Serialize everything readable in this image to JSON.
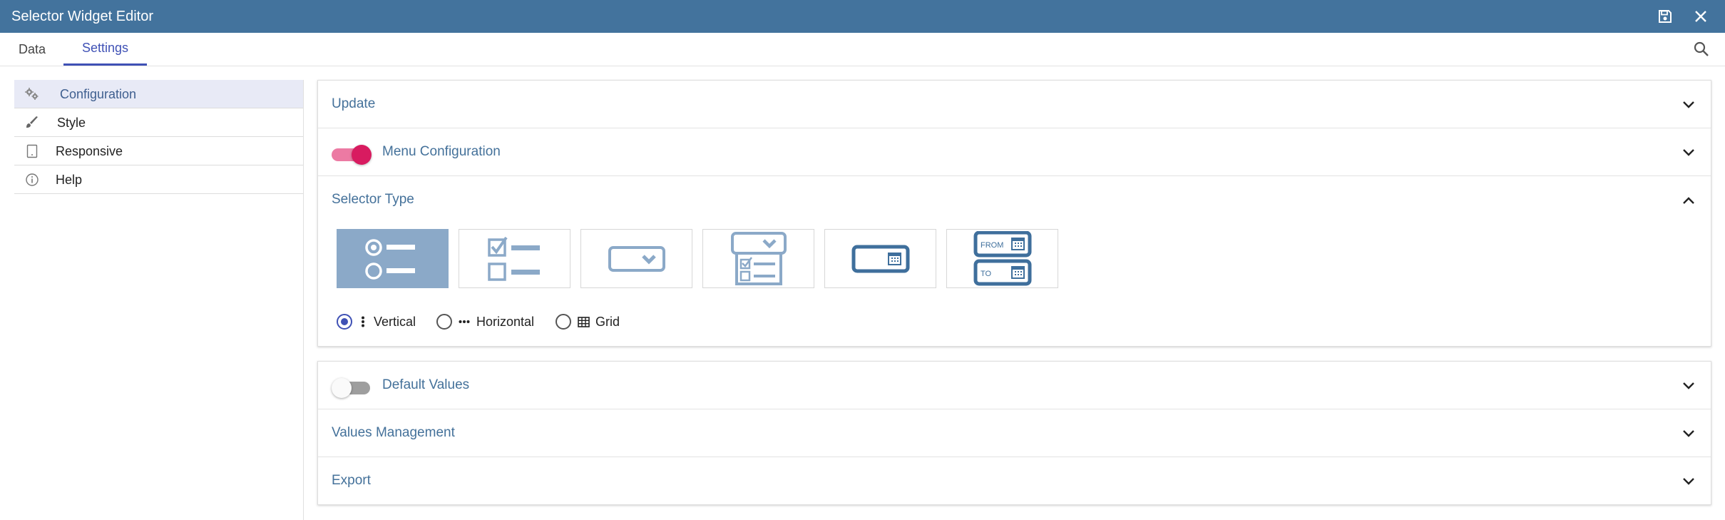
{
  "window": {
    "title": "Selector Widget Editor",
    "save_icon": "save-icon",
    "close_icon": "close-icon",
    "titlebar_color": "#43739d"
  },
  "tabs": [
    {
      "label": "Data",
      "active": false
    },
    {
      "label": "Settings",
      "active": true
    }
  ],
  "accent_color": "#3f51b5",
  "sidebar": {
    "items": [
      {
        "label": "Configuration",
        "icon": "gears-icon",
        "active": true
      },
      {
        "label": "Style",
        "icon": "brush-icon",
        "active": false
      },
      {
        "label": "Responsive",
        "icon": "tablet-icon",
        "active": false
      },
      {
        "label": "Help",
        "icon": "info-icon",
        "active": false
      }
    ]
  },
  "panels": {
    "update": {
      "label": "Update",
      "expanded": false
    },
    "menu_configuration": {
      "label": "Menu Configuration",
      "toggle_on": true,
      "expanded": false
    },
    "selector_type": {
      "label": "Selector Type",
      "expanded": true,
      "types": [
        {
          "name": "radio-list",
          "selected": true
        },
        {
          "name": "checkbox-list",
          "selected": false
        },
        {
          "name": "dropdown",
          "selected": false
        },
        {
          "name": "multi-select-dropdown",
          "selected": false
        },
        {
          "name": "date-picker",
          "selected": false
        },
        {
          "name": "date-range-picker",
          "selected": false,
          "from_label": "FROM",
          "to_label": "TO"
        }
      ],
      "orientation": [
        {
          "label": "Vertical",
          "icon": "vertical-dots-icon",
          "checked": true
        },
        {
          "label": "Horizontal",
          "icon": "horizontal-dots-icon",
          "checked": false
        },
        {
          "label": "Grid",
          "icon": "grid-icon",
          "checked": false
        }
      ]
    },
    "default_values": {
      "label": "Default Values",
      "toggle_on": false,
      "expanded": false
    },
    "values_management": {
      "label": "Values Management",
      "expanded": false
    },
    "export": {
      "label": "Export",
      "expanded": false
    }
  }
}
